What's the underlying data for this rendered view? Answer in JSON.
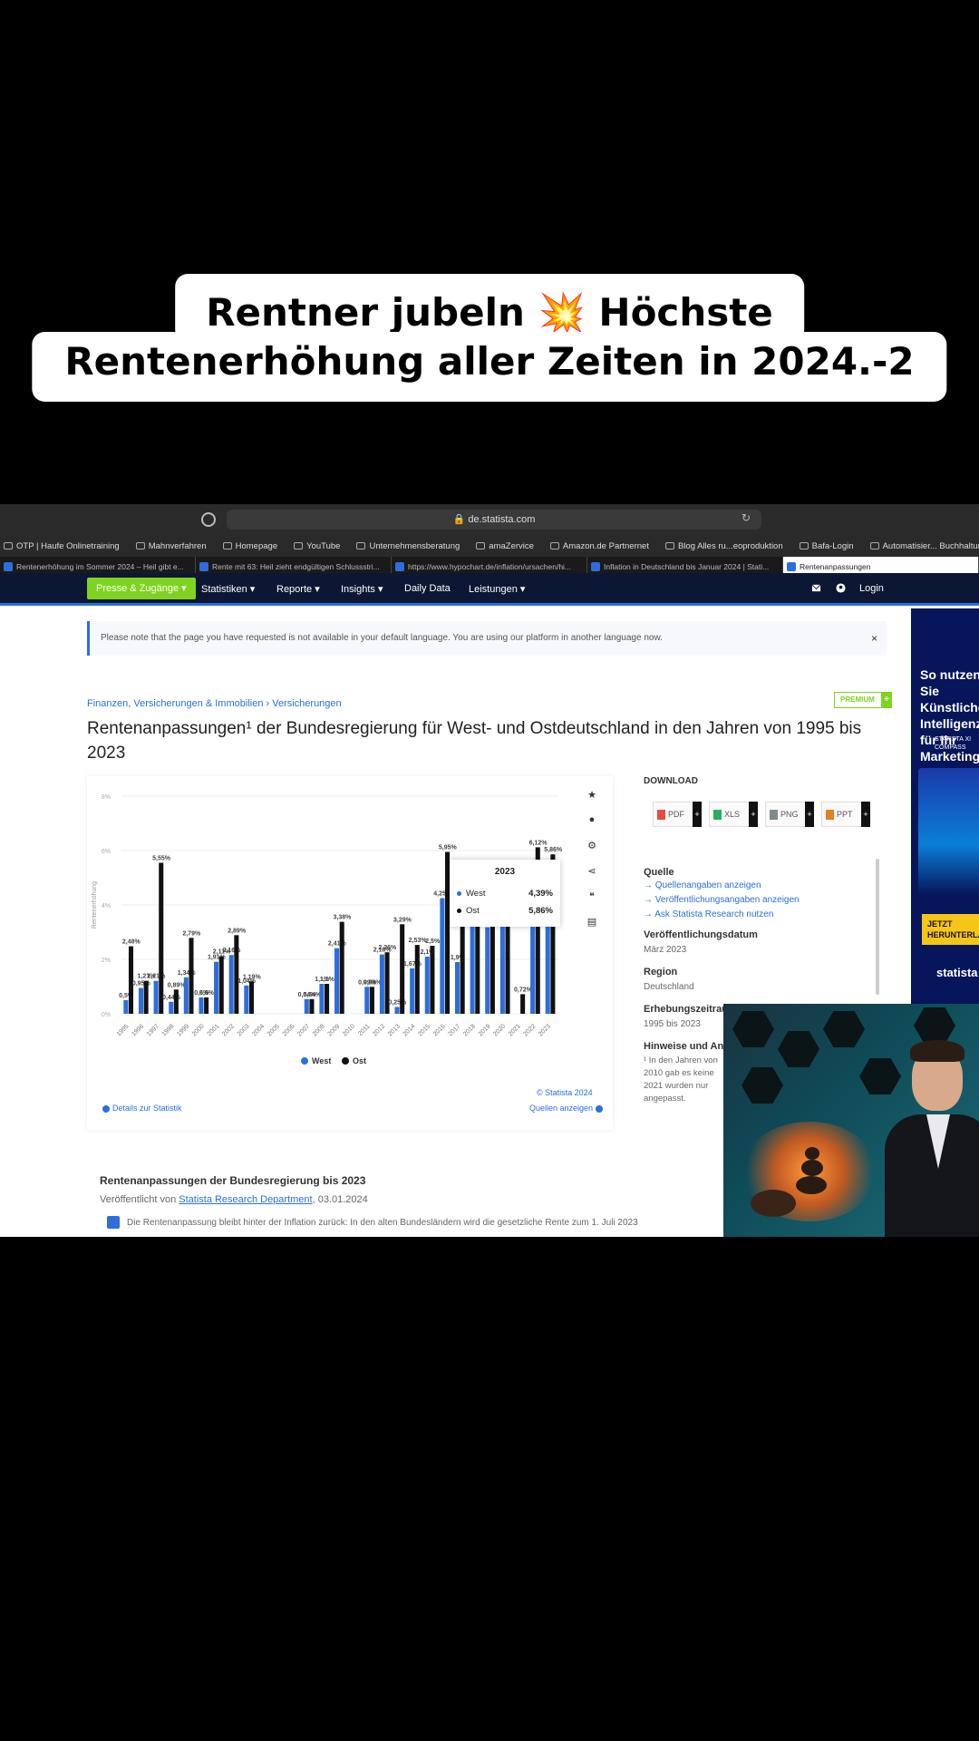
{
  "caption": {
    "line1_pre": "Rentner jubeln ",
    "line1_emoji": "💥",
    "line1_post": " Höchste",
    "line2": "Rentenerhöhung aller Zeiten in 2024.-2"
  },
  "browser": {
    "url": "de.statista.com",
    "bookmarks": [
      "OTP | Haufe Onlinetraining",
      "Mahnverfahren",
      "Homepage",
      "YouTube",
      "Unternehmensberatung",
      "amaZervice",
      "Amazon.de Partnernet",
      "Blog Alles ru...eoproduktion",
      "Bafa-Login",
      "Automatisier... Buchhaltung"
    ],
    "tabs": [
      "Rentenerhöhung im Sommer 2024 – Heil gibt e...",
      "Rente mit 63: Heil zieht endgültigen Schlussstri...",
      "https://www.hypochart.de/inflation/ursachen/hi...",
      "Inflation in Deutschland bis Januar 2024 | Stati...",
      "Rentenanpassungen"
    ]
  },
  "nav": {
    "press_button": "Presse & Zugänge ▾",
    "items": [
      "Statistiken ▾",
      "Reporte ▾",
      "Insights ▾",
      "Daily Data",
      "Leistungen ▾"
    ],
    "login": "Login"
  },
  "notice": {
    "text": "Please note that the page you have requested is not available in your default language. You are using our platform in another language now.",
    "close": "×"
  },
  "breadcrumb": "Finanzen, Versicherungen & Immobilien › Versicherungen",
  "premium": "PREMIUM",
  "title": "Rentenanpassungen¹ der Bundesregierung für West- und Ostdeutschland in den Jahren von 1995 bis 2023",
  "chart_data": {
    "type": "bar",
    "ylabel": "Rentenerhöhung",
    "ylim": [
      0,
      8
    ],
    "yticks": [
      "0%",
      "2%",
      "4%",
      "6%",
      "8%"
    ],
    "categories": [
      "1995",
      "1996",
      "1997",
      "1998",
      "1999",
      "2000",
      "2001",
      "2002",
      "2003",
      "2004",
      "2005",
      "2006",
      "2007",
      "2008",
      "2009",
      "2010",
      "2011",
      "2012",
      "2013",
      "2014",
      "2015",
      "2016",
      "2017",
      "2018",
      "2019",
      "2020",
      "2021",
      "2022",
      "2023"
    ],
    "series": [
      {
        "name": "West",
        "color": "#2d6edc",
        "values": [
          0.5,
          0.95,
          1.21,
          0.44,
          1.34,
          0.6,
          1.91,
          2.16,
          1.04,
          0,
          0,
          0,
          0.54,
          1.1,
          2.41,
          0,
          0.99,
          2.18,
          0.25,
          1.67,
          2.1,
          4.25,
          1.9,
          3.22,
          3.18,
          3.45,
          0,
          5.35,
          4.39
        ]
      },
      {
        "name": "Ost",
        "color": "#111111",
        "values": [
          2.48,
          1.21,
          5.55,
          0.89,
          2.79,
          0.6,
          2.11,
          2.89,
          1.19,
          0,
          0,
          0,
          0.54,
          1.1,
          3.38,
          0,
          0.99,
          2.26,
          3.29,
          2.53,
          2.5,
          5.95,
          3.59,
          3.37,
          3.91,
          4.2,
          0.72,
          6.12,
          5.86
        ]
      }
    ],
    "labels_shown": [
      "0,5",
      "0,95",
      "1,21",
      "1,65",
      "5,55",
      "0,44",
      "0,89",
      "1,34",
      "2,79",
      "0,6",
      "1,91",
      "2,11",
      "2,16",
      "2,89",
      "1,04",
      "1,19",
      "0,54",
      "1,1",
      "2,41",
      "3,38",
      "0,99",
      "2,18",
      "2,26",
      "3,29",
      "0,25",
      "1,67",
      "2,53",
      "2,1",
      "5,95",
      "1,9",
      "6,12",
      "5,35",
      "0,72",
      "5,86",
      "4,39"
    ],
    "label_suffix": "%",
    "tooltip": {
      "year": "2023",
      "rows": [
        {
          "name": "West",
          "value": "4,39%"
        },
        {
          "name": "Ost",
          "value": "5,86%"
        }
      ]
    }
  },
  "chart_footer": {
    "source": "© Statista 2024",
    "details": "Details zur Statistik",
    "quellen": "Quellen anzeigen"
  },
  "sidebar": {
    "download": "DOWNLOAD",
    "buttons": [
      "PDF",
      "XLS",
      "PNG",
      "PPT"
    ],
    "quelle_h": "Quelle",
    "quelle_links": [
      "Quellenangaben anzeigen",
      "Veröffentlichungsangaben anzeigen",
      "Ask Statista Research nutzen"
    ],
    "pub_h": "Veröffentlichungsdatum",
    "pub_v": "März 2023",
    "region_h": "Region",
    "region_v": "Deutschland",
    "period_h": "Erhebungszeitraum",
    "period_v": "1995 bis 2023",
    "notes_h": "Hinweise und Anmerkungen",
    "notes_v": "¹ In den Jahren von 2010 gab es keine 2021 wurden nur angepasst."
  },
  "below": {
    "title": "Rentenanpassungen der Bundesregierung bis 2023",
    "sub_pre": "Veröffentlicht von ",
    "sub_link": "Statista Research Department",
    "sub_post": ", 03.01.2024",
    "text": "Die Rentenanpassung bleibt hinter der Inflation zurück: In den alten Bundesländern wird die gesetzliche Rente zum 1. Juli 2023"
  },
  "ad": {
    "headline": "So nutzen Sie Künstliche Intelligenz für Ihr Marketing",
    "compass": "STATISTA XI COMPASS",
    "button": "JETZT HERUNTERLADEN",
    "brand": "statista"
  }
}
